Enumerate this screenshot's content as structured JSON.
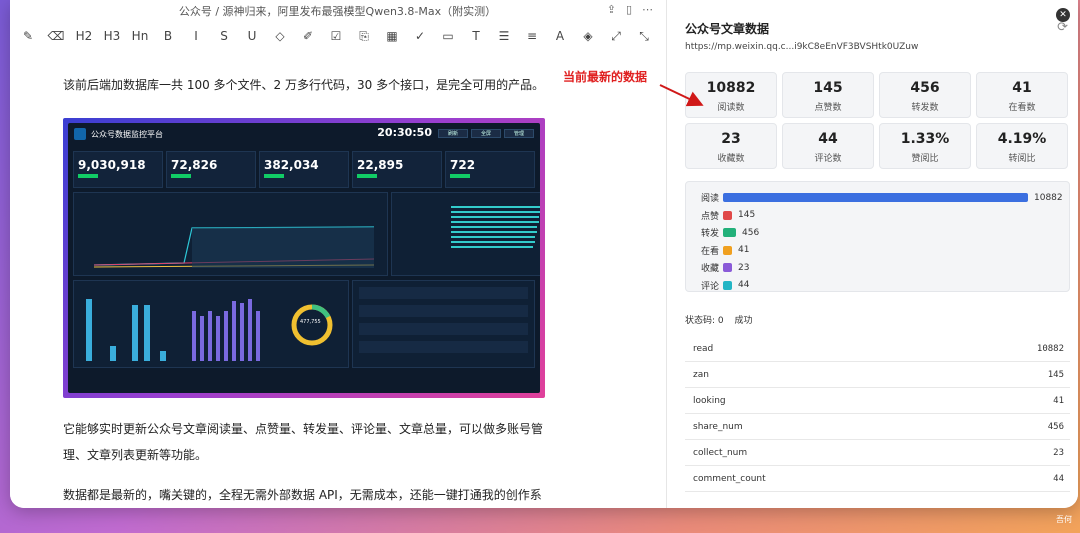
{
  "editor": {
    "breadcrumb": "公众号 / 源神归来，阿里发布最强模型Qwen3.8-Max（附实测）",
    "toolbar": [
      "✎",
      "⌫",
      "H2",
      "H3",
      "Hn",
      "B",
      "I",
      "S",
      "U",
      "◇",
      "✐",
      "☑",
      "⎘",
      "▦",
      "✓",
      "▭",
      "T",
      "☰",
      "≡",
      "A",
      "◈",
      "⤢",
      "⤡"
    ],
    "p1": "该前后端加数据库一共 100 多个文件、2 万多行代码，30 多个接口，是完全可用的产品。",
    "p2": "它能够实时更新公众号文章阅读量、点赞量、转发量、评论量、文章总量，可以做多账号管理、文章列表更新等功能。",
    "p3": "数据都是最新的，嘴关键的，全程无需外部数据 API，无需成本，还能一键打通我的创作系统。"
  },
  "dashboard": {
    "title": "公众号数据监控平台",
    "time": "20:30:50",
    "buttons": [
      "刷新",
      "全屏",
      "管理"
    ],
    "kpis": [
      "9,030,918",
      "72,826",
      "382,034",
      "22,895",
      "722"
    ],
    "donut_value": "477,755"
  },
  "annotation": "当前最新的数据",
  "panel": {
    "title": "公众号文章数据",
    "url": "https://mp.weixin.qq.c...i9kC8eEnVF3BVSHtk0UZuw",
    "cards": [
      {
        "value": "10882",
        "label": "阅读数"
      },
      {
        "value": "145",
        "label": "点赞数"
      },
      {
        "value": "456",
        "label": "转发数"
      },
      {
        "value": "41",
        "label": "在看数"
      },
      {
        "value": "23",
        "label": "收藏数"
      },
      {
        "value": "44",
        "label": "评论数"
      },
      {
        "value": "1.33%",
        "label": "赞阅比"
      },
      {
        "value": "4.19%",
        "label": "转阅比"
      }
    ],
    "bars": [
      {
        "label": "阅读",
        "value": 10882,
        "text": "10882",
        "color": "#3b6fe0"
      },
      {
        "label": "点赞",
        "value": 145,
        "text": "145",
        "color": "#e04848"
      },
      {
        "label": "转发",
        "value": 456,
        "text": "456",
        "color": "#22b07a"
      },
      {
        "label": "在看",
        "value": 41,
        "text": "41",
        "color": "#f0a020"
      },
      {
        "label": "收藏",
        "value": 23,
        "text": "23",
        "color": "#8a5ad8"
      },
      {
        "label": "评论",
        "value": 44,
        "text": "44",
        "color": "#22b5c5"
      }
    ],
    "status_label": "状态码: 0",
    "status_value": "成功",
    "table": [
      {
        "key": "read",
        "value": "10882"
      },
      {
        "key": "zan",
        "value": "145"
      },
      {
        "key": "looking",
        "value": "41"
      },
      {
        "key": "share_num",
        "value": "456"
      },
      {
        "key": "collect_num",
        "value": "23"
      },
      {
        "key": "comment_count",
        "value": "44"
      }
    ]
  },
  "corner_badge": "吾何"
}
